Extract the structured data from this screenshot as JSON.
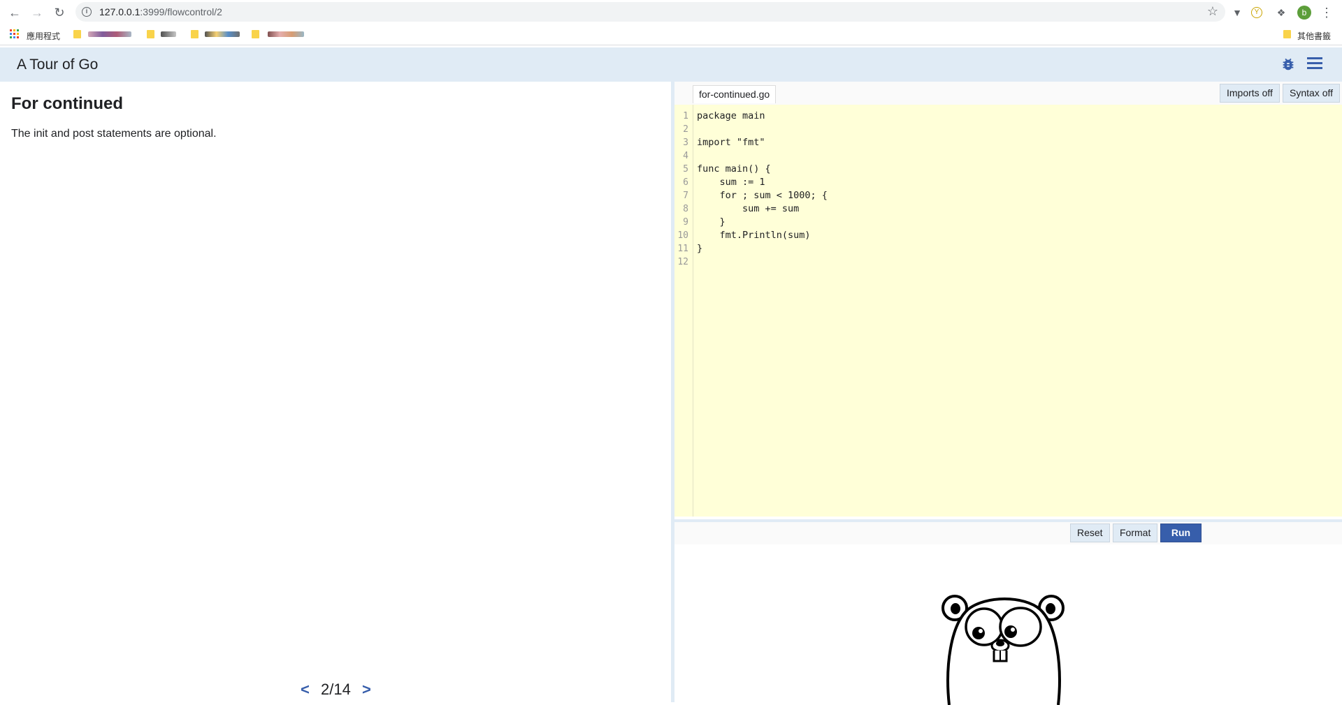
{
  "browser": {
    "url_host": "127.0.0.1",
    "url_path": ":3999/flowcontrol/2",
    "apps_label": "應用程式",
    "other_bookmarks_label": "其他書籤",
    "avatar_letter": "b"
  },
  "header": {
    "title": "A Tour of Go"
  },
  "lesson": {
    "heading": "For continued",
    "body": "The init and post statements are optional.",
    "prev": "<",
    "page": "2/14",
    "next": ">"
  },
  "editor": {
    "filename": "for-continued.go",
    "imports_label": "Imports off",
    "syntax_label": "Syntax off",
    "line_numbers": [
      "1",
      "2",
      "3",
      "4",
      "5",
      "6",
      "7",
      "8",
      "9",
      "10",
      "11",
      "12"
    ],
    "lines": [
      "package main",
      "",
      "import \"fmt\"",
      "",
      "func main() {",
      "    sum := 1",
      "    for ; sum < 1000; {",
      "        sum += sum",
      "    }",
      "    fmt.Println(sum)",
      "}",
      ""
    ],
    "reset_label": "Reset",
    "format_label": "Format",
    "run_label": "Run"
  },
  "colors": {
    "header_bg": "#e0ebf5",
    "code_bg": "#ffffd8",
    "accent": "#375eab"
  }
}
